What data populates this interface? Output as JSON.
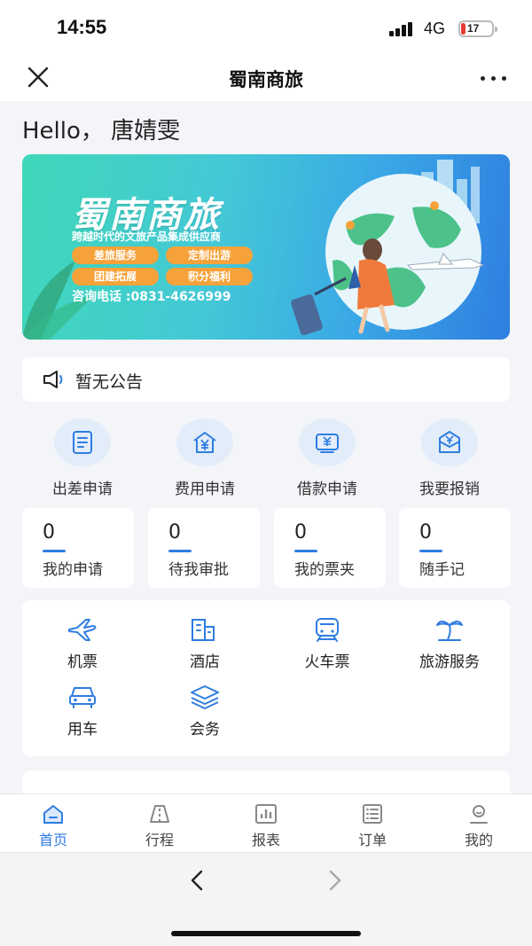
{
  "status": {
    "time": "14:55",
    "network": "4G",
    "battery": "17"
  },
  "nav": {
    "title": "蜀南商旅"
  },
  "greeting": "Hello，  唐婧雯",
  "banner": {
    "title": "蜀南商旅",
    "subtitle": "跨越时代的文旅产品集成供应商",
    "tags": [
      "差旅服务",
      "定制出游",
      "团建拓展",
      "积分福利"
    ],
    "phone": "咨询电话 :0831-4626999"
  },
  "notice": {
    "text": "暂无公告"
  },
  "quick_actions": [
    {
      "label": "出差申请",
      "icon": "document-icon"
    },
    {
      "label": "费用申请",
      "icon": "yuan-house-icon"
    },
    {
      "label": "借款申请",
      "icon": "yuan-card-icon"
    },
    {
      "label": "我要报销",
      "icon": "yuan-envelope-icon"
    }
  ],
  "stats": [
    {
      "value": "0",
      "label": "我的申请"
    },
    {
      "value": "0",
      "label": "待我审批"
    },
    {
      "value": "0",
      "label": "我的票夹"
    },
    {
      "value": "0",
      "label": "随手记"
    }
  ],
  "services": [
    {
      "label": "机票",
      "icon": "plane-icon"
    },
    {
      "label": "酒店",
      "icon": "hotel-icon"
    },
    {
      "label": "火车票",
      "icon": "train-icon"
    },
    {
      "label": "旅游服务",
      "icon": "palm-tree-icon"
    },
    {
      "label": "用车",
      "icon": "car-icon"
    },
    {
      "label": "会务",
      "icon": "layers-icon"
    }
  ],
  "tabs": [
    {
      "label": "首页",
      "icon": "home-icon",
      "active": true
    },
    {
      "label": "行程",
      "icon": "road-icon"
    },
    {
      "label": "报表",
      "icon": "bar-chart-icon"
    },
    {
      "label": "订单",
      "icon": "list-icon"
    },
    {
      "label": "我的",
      "icon": "user-icon"
    }
  ],
  "colors": {
    "accent": "#2f7de1",
    "icon_bg": "#e3edfa",
    "tag": "#f6a23a",
    "battery_low": "#e53935"
  }
}
